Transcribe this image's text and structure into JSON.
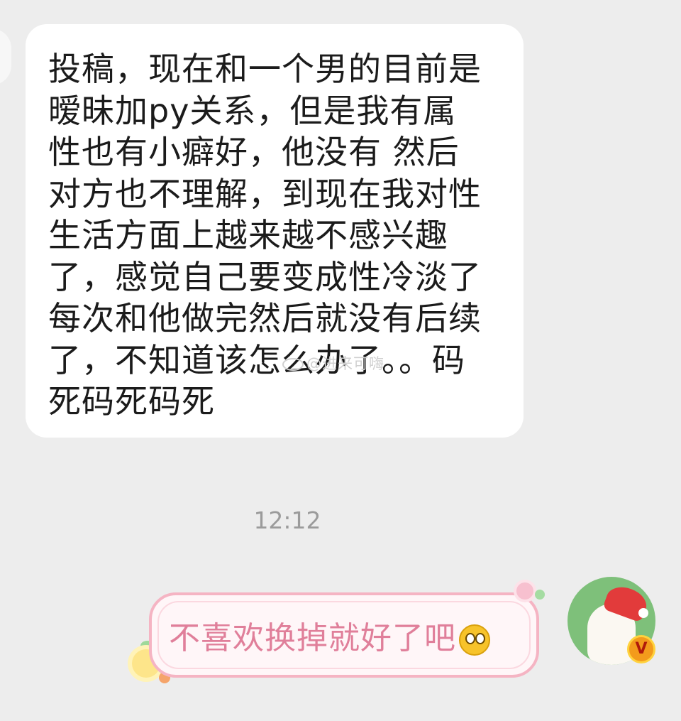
{
  "incoming_message": {
    "lines": [
      "投稿，现在和一个男的目前是",
      "暧昧加py关系，但是我有属",
      "性也有小癖好，他没有 然后",
      "对方也不理解，到现在我对性",
      "生活方面上越来越不感兴趣",
      "了，感觉自己要变成性冷淡了",
      "每次和他做完然后就没有后续",
      "了，不知道该怎么办了。。码",
      "死码死码死"
    ]
  },
  "watermark": "@进来可嗨",
  "timestamp": "12:12",
  "outgoing_message": {
    "text": "不喜欢换掉就好了吧",
    "emoji": "thinking-face-icon"
  },
  "avatar": {
    "description_icon": "bear-santa-hat-avatar",
    "badge": "V"
  },
  "colors": {
    "background": "#ededed",
    "incoming_bubble": "#ffffff",
    "outgoing_bubble_border": "#f5b4c3",
    "outgoing_text": "#e07f9a",
    "timestamp": "#9b9b9b"
  }
}
